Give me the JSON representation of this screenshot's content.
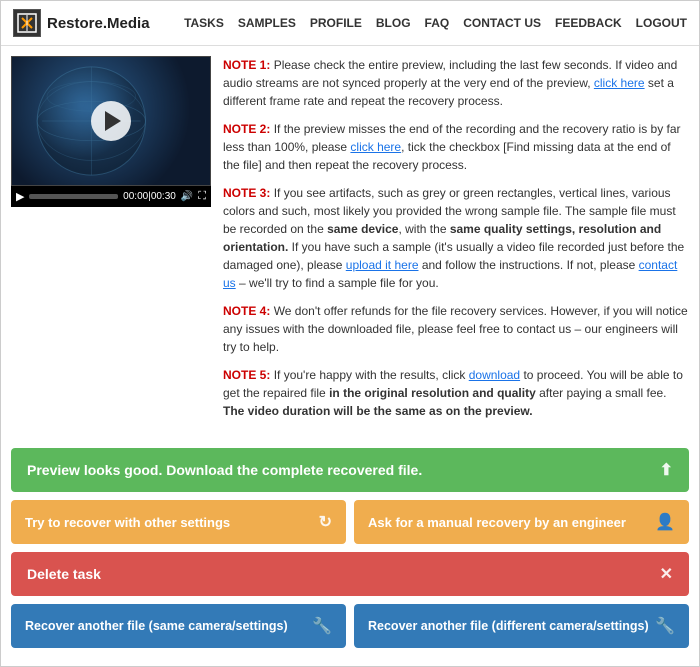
{
  "nav": {
    "logo": "Restore.Media",
    "links": [
      "TASKS",
      "SAMPLES",
      "PROFILE",
      "BLOG",
      "FAQ",
      "CONTACT US",
      "FEEDBACK",
      "LOGOUT"
    ]
  },
  "video": {
    "time_current": "00:00",
    "time_total": "00:30"
  },
  "notes": [
    {
      "id": "note1",
      "label": "NOTE 1:",
      "color": "red",
      "text_before": " Please check the entire preview, including the last few seconds. If video and audio streams are not synced properly at the very end of the preview, ",
      "link_text": "click here",
      "text_after": " set a different frame rate and repeat the recovery process."
    },
    {
      "id": "note2",
      "label": "NOTE 2:",
      "color": "red",
      "text_before": " If the preview misses the end of the recording and the recovery ratio is by far less than 100%, please ",
      "link_text": "click here",
      "text_after": ", tick the checkbox [Find missing data at the end of the file] and then repeat the recovery process."
    },
    {
      "id": "note3",
      "label": "NOTE 3:",
      "color": "red",
      "text_before": " If you see artifacts, such as grey or green rectangles, vertical lines, various colors and such, most likely you provided the wrong sample file. The sample file must be recorded on the ",
      "bold1": "same device",
      "text_mid1": ", with the ",
      "bold2": "same quality settings, resolution and orientation.",
      "text_mid2": " If you have such a sample (it's usually a video file recorded just before the damaged one), please ",
      "link_text": "upload it here",
      "text_after": " and follow the instructions. If not, please ",
      "link2_text": "contact us",
      "text_end": " – we'll try to find a sample file for you."
    },
    {
      "id": "note4",
      "label": "NOTE 4:",
      "color": "red",
      "text_before": " We don't offer refunds for the file recovery services. However, if you will notice any issues with the downloaded file, please feel free to contact us – our engineers will try to help."
    },
    {
      "id": "note5",
      "label": "NOTE 5:",
      "color": "red",
      "text_before": " If you're happy with the results, click ",
      "link_text": "download",
      "text_mid": " to proceed. You will be able to get the repaired file ",
      "bold1": "in the original resolution and quality",
      "text_after": " after paying a small fee. ",
      "bold2": "The video duration will be the same as on the preview."
    }
  ],
  "buttons": {
    "green_label": "Preview looks good. Download the complete recovered file.",
    "orange1_label": "Try to recover with other settings",
    "orange2_label": "Ask for a manual recovery by an engineer",
    "red_label": "Delete task",
    "blue1_label": "Recover another file (same camera/settings)",
    "blue2_label": "Recover another file (different camera/settings)"
  }
}
